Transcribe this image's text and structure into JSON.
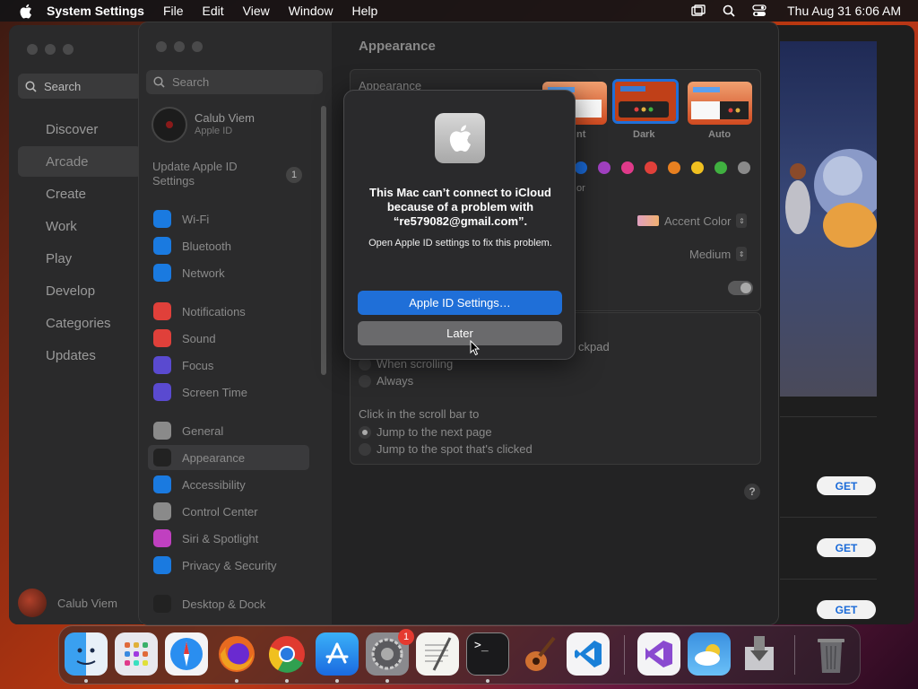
{
  "menubar": {
    "app_name": "System Settings",
    "menus": [
      "File",
      "Edit",
      "View",
      "Window",
      "Help"
    ],
    "clock": "Thu Aug 31  6:06 AM"
  },
  "store": {
    "search_placeholder": "Search",
    "nav": [
      "Discover",
      "Arcade",
      "Create",
      "Work",
      "Play",
      "Develop",
      "Categories",
      "Updates"
    ],
    "selected_nav": "Arcade",
    "user_name": "Calub Viem",
    "get_label": "GET"
  },
  "settings": {
    "search_placeholder": "Search",
    "user_name": "Calub Viem",
    "user_sub": "Apple ID",
    "update_label": "Update Apple ID Settings",
    "update_count": "1",
    "sidebar": [
      {
        "label": "Wi-Fi",
        "icon": "wifi-icon",
        "color": "#1a7ae0"
      },
      {
        "label": "Bluetooth",
        "icon": "bluetooth-icon",
        "color": "#1a7ae0"
      },
      {
        "label": "Network",
        "icon": "globe-icon",
        "color": "#1a7ae0"
      },
      {
        "label": "Notifications",
        "icon": "bell-icon",
        "color": "#e0403a"
      },
      {
        "label": "Sound",
        "icon": "speaker-icon",
        "color": "#e0403a"
      },
      {
        "label": "Focus",
        "icon": "moon-icon",
        "color": "#5a4ad0"
      },
      {
        "label": "Screen Time",
        "icon": "hourglass-icon",
        "color": "#5a4ad0"
      },
      {
        "label": "General",
        "icon": "gear-icon",
        "color": "#8a8a8a"
      },
      {
        "label": "Appearance",
        "icon": "appearance-icon",
        "color": "#222222"
      },
      {
        "label": "Accessibility",
        "icon": "accessibility-icon",
        "color": "#1a7ae0"
      },
      {
        "label": "Control Center",
        "icon": "control-center-icon",
        "color": "#8a8a8a"
      },
      {
        "label": "Siri & Spotlight",
        "icon": "siri-icon",
        "color": "#c040c0"
      },
      {
        "label": "Privacy & Security",
        "icon": "hand-icon",
        "color": "#1a7ae0"
      },
      {
        "label": "Desktop & Dock",
        "icon": "dock-icon",
        "color": "#222222"
      }
    ],
    "selected": "Appearance",
    "main_title": "Appearance",
    "appearance_label": "Appearance",
    "themes": [
      "Light",
      "Dark",
      "Auto"
    ],
    "theme_partial_light": "nt",
    "selected_theme": "Dark",
    "accent_colors": [
      "#1a6ad8",
      "#a040c0",
      "#e03a8a",
      "#e0403a",
      "#e88020",
      "#f0c020",
      "#40b040",
      "#8a8a8a"
    ],
    "accent_partial": "or",
    "highlight_label": "Accent Color",
    "sidebar_size_value": "Medium",
    "scroll_partial": "ckpad",
    "radio_when_scrolling": "When scrolling",
    "radio_always": "Always",
    "click_scroll_label": "Click in the scroll bar to",
    "radio_next_page": "Jump to the next page",
    "radio_spot": "Jump to the spot that's clicked",
    "help": "?"
  },
  "dialog": {
    "title": "This Mac can’t connect to iCloud because of a problem with “re579082@gmail.com”.",
    "message": "Open Apple ID settings to fix this problem.",
    "primary": "Apple ID Settings…",
    "secondary": "Later"
  },
  "dock": {
    "apps": [
      "Finder",
      "Launchpad",
      "Safari",
      "Firefox",
      "Chrome",
      "App Store",
      "System Settings",
      "TextEdit",
      "Terminal",
      "GarageBand",
      "Visual Studio Code",
      "Visual Studio",
      "Weather",
      "Installer",
      "Trash"
    ],
    "settings_badge": "1"
  }
}
